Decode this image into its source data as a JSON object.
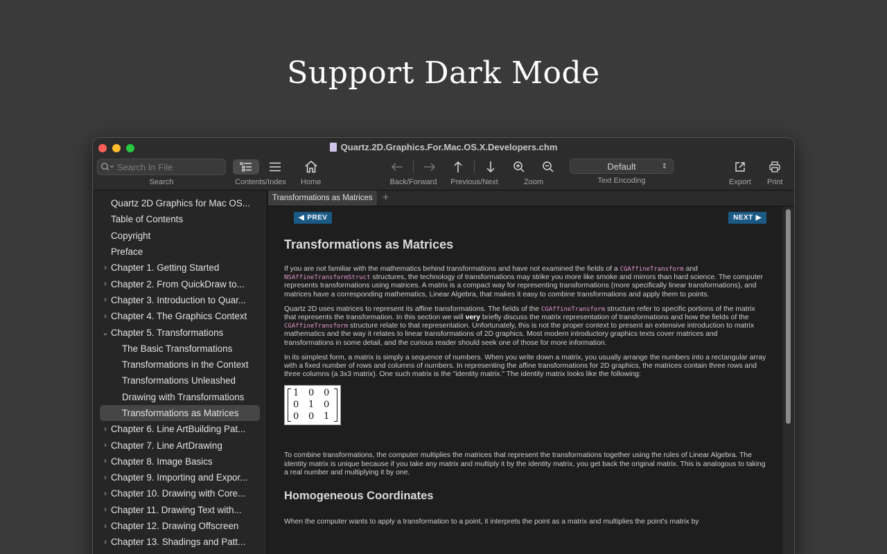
{
  "hero_title": "Support Dark Mode",
  "window": {
    "title": "Quartz.2D.Graphics.For.Mac.OS.X.Developers.chm"
  },
  "toolbar": {
    "search": {
      "placeholder": "Search In File",
      "label": "Search"
    },
    "contents_index_label": "Contents/Index",
    "home_label": "Home",
    "back_forward_label": "Back/Forward",
    "prev_next_label": "Previous/Next",
    "zoom_label": "Zoom",
    "encoding": {
      "value": "Default",
      "label": "Text Encoding"
    },
    "export_label": "Export",
    "print_label": "Print"
  },
  "sidebar": {
    "items": [
      {
        "label": "Quartz 2D Graphics for Mac OS...",
        "level": 0,
        "arrow": "none"
      },
      {
        "label": "Table of Contents",
        "level": 0,
        "arrow": "none"
      },
      {
        "label": "Copyright",
        "level": 0,
        "arrow": "none"
      },
      {
        "label": "Preface",
        "level": 0,
        "arrow": "none"
      },
      {
        "label": "Chapter 1.  Getting Started",
        "level": 0,
        "arrow": "collapsed"
      },
      {
        "label": "Chapter 2.  From QuickDraw to...",
        "level": 0,
        "arrow": "collapsed"
      },
      {
        "label": "Chapter 3.  Introduction to Quar...",
        "level": 0,
        "arrow": "collapsed"
      },
      {
        "label": "Chapter 4.  The Graphics Context",
        "level": 0,
        "arrow": "collapsed"
      },
      {
        "label": "Chapter 5.  Transformations",
        "level": 0,
        "arrow": "expanded"
      },
      {
        "label": "The Basic Transformations",
        "level": 1,
        "arrow": "none"
      },
      {
        "label": "Transformations in the Context",
        "level": 1,
        "arrow": "none"
      },
      {
        "label": "Transformations Unleashed",
        "level": 1,
        "arrow": "none"
      },
      {
        "label": "Drawing with Transformations",
        "level": 1,
        "arrow": "none"
      },
      {
        "label": "Transformations as Matrices",
        "level": 1,
        "arrow": "none",
        "selected": true
      },
      {
        "label": "Chapter 6.  Line ArtBuilding Pat...",
        "level": 0,
        "arrow": "collapsed"
      },
      {
        "label": "Chapter 7.  Line ArtDrawing",
        "level": 0,
        "arrow": "collapsed"
      },
      {
        "label": "Chapter 8.  Image Basics",
        "level": 0,
        "arrow": "collapsed"
      },
      {
        "label": "Chapter 9.  Importing and Expor...",
        "level": 0,
        "arrow": "collapsed"
      },
      {
        "label": "Chapter 10.  Drawing with Core...",
        "level": 0,
        "arrow": "collapsed"
      },
      {
        "label": "Chapter 11.  Drawing Text with...",
        "level": 0,
        "arrow": "collapsed"
      },
      {
        "label": "Chapter 12.  Drawing Offscreen",
        "level": 0,
        "arrow": "collapsed"
      },
      {
        "label": "Chapter 13.  Shadings and Patt...",
        "level": 0,
        "arrow": "collapsed"
      }
    ]
  },
  "tabs": [
    {
      "label": "Transformations as Matrices"
    }
  ],
  "page": {
    "prev_label": "PREV",
    "next_label": "NEXT",
    "heading": "Transformations as Matrices",
    "p1": {
      "a": "If you are not familiar with the mathematics behind transformations and have not examined the fields of a ",
      "code1": "CGAffineTransform",
      "b": " and ",
      "code2": "NSAffineTransformStruct",
      "c": " structures, the technology of transformations may strike you more like smoke and mirrors than hard science. The computer represents transformations using matrices. A matrix is a compact way for representing transformations (more specifically linear transformations), and matrices have a corresponding mathematics, Linear Algebra, that makes it easy to combine transformations and apply them to points."
    },
    "p2": {
      "a": "Quartz 2D uses matrices to represent its affine transformations. The fields of the ",
      "code1": "CGAffineTransform",
      "b": " structure refer to specific portions of the matrix that represents the transformation. In this section we will ",
      "bold": "very",
      "c": " briefly discuss the matrix representation of transformations and how the fields of the ",
      "code2": "CGAffineTransform",
      "d": " structure relate to that representation. Unfortunately, this is not the proper context to present an extensive introduction to matrix mathematics and the way it relates to linear transformations of 2D graphics. Most modern introductory graphics texts cover matrices and transformations in some detail, and the curious reader should seek one of those for more information."
    },
    "p3": "In its simplest form, a matrix is simply a sequence of numbers. When you write down a matrix, you usually arrange the numbers into a rectangular array with a fixed number of rows and columns of numbers. In representing the affine transformations for 2D graphics, the matrices contain three rows and three columns (a 3x3 matrix). One such matrix is the \"identity matrix.\" The identity matrix looks like the following:",
    "matrix": [
      "1",
      "0",
      "0",
      "0",
      "1",
      "0",
      "0",
      "0",
      "1"
    ],
    "p4": "To combine transformations, the computer multiplies the matrices that represent the transformations together using the rules of Linear Algebra. The identity matrix is unique because if you take any matrix and multiply it by the identity matrix, you get back the original matrix. This is analogous to taking a real number and multiplying it by one.",
    "heading2": "Homogeneous Coordinates",
    "p5": "When the computer wants to apply a transformation to a point, it interprets the point as a matrix and multiplies the point's matrix by"
  },
  "colors": {
    "background": "#3a3a3a",
    "code_pink": "#e59acf",
    "nav_button_blue": "#1c5a86",
    "selected_row": "#464646"
  }
}
